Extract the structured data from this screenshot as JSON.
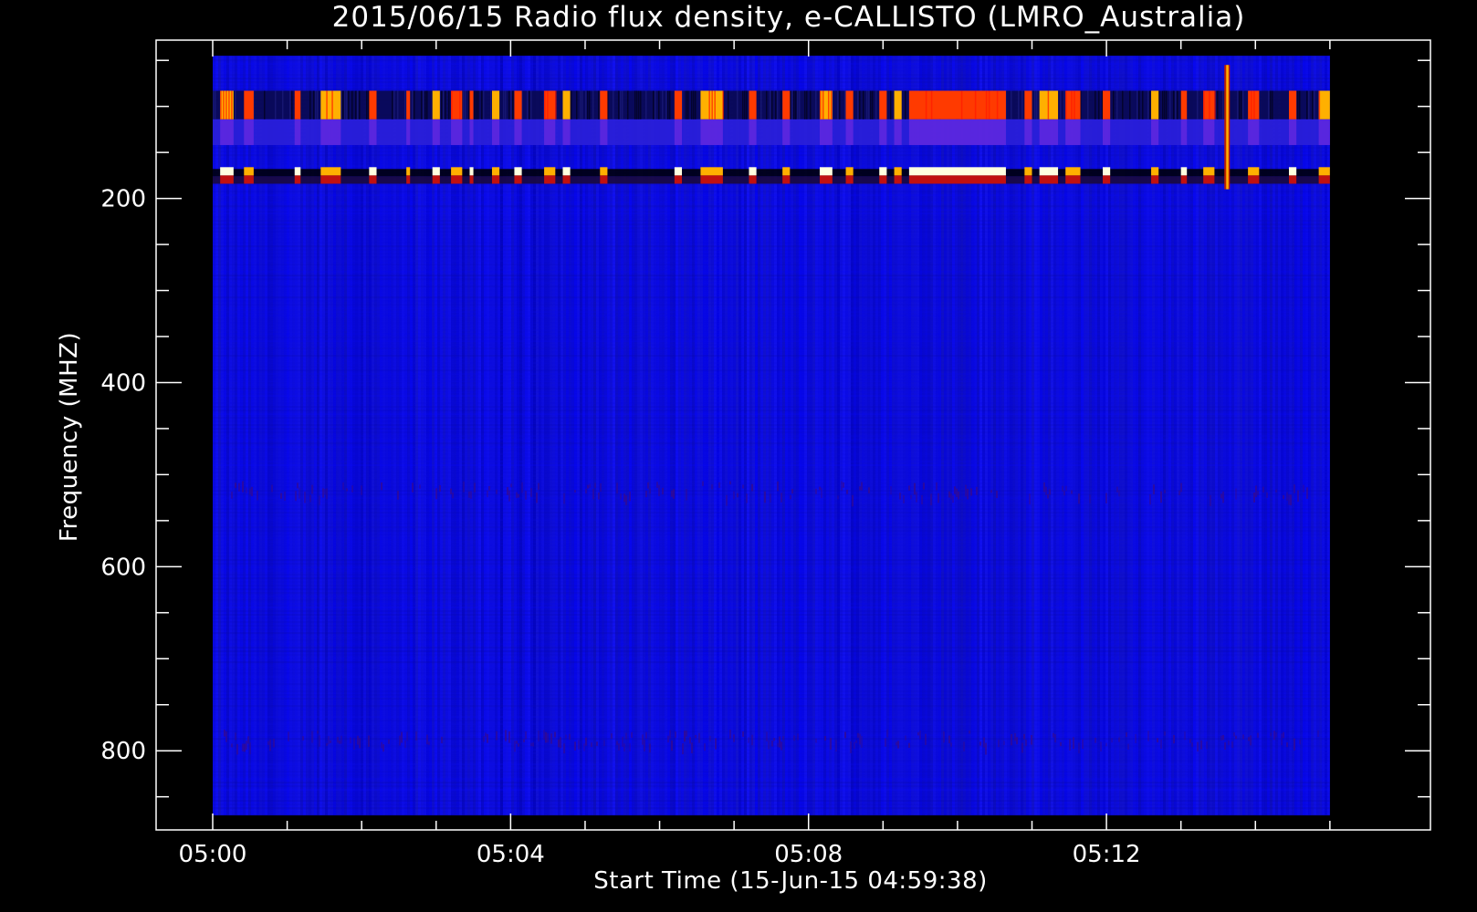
{
  "chart_data": {
    "type": "heatmap",
    "title": "2015/06/15  Radio flux density, e-CALLISTO (LMRO_Australia)",
    "xlabel": "Start Time (15-Jun-15 04:59:38)",
    "ylabel": "Frequency (MHZ)",
    "x_axis": {
      "unit": "UTC time (minutes after 05:00)",
      "range_minutes": [
        -0.76,
        16.35
      ],
      "data_extent_minutes": [
        0,
        15
      ],
      "major_ticks": [
        {
          "minutes": 0,
          "label": "05:00"
        },
        {
          "minutes": 4,
          "label": "05:04"
        },
        {
          "minutes": 8,
          "label": "05:08"
        },
        {
          "minutes": 12,
          "label": "05:12"
        }
      ],
      "minor_step_minutes": 1
    },
    "y_axis": {
      "unit": "MHz",
      "inverted": true,
      "range": [
        28,
        886
      ],
      "data_extent": [
        45,
        870
      ],
      "major_ticks": [
        {
          "value": 200,
          "label": "200"
        },
        {
          "value": 400,
          "label": "400"
        },
        {
          "value": 600,
          "label": "600"
        },
        {
          "value": 800,
          "label": "800"
        }
      ],
      "minor_step": 50
    },
    "colormap": {
      "background": "#000000",
      "low": "#0000c8",
      "mid": "#0000ff",
      "dark": "#000030",
      "warm": "#ff3a00",
      "hot": "#ffb000",
      "white": "#ffffe0"
    },
    "background_level_color": "#0c0cdc",
    "bands": [
      {
        "name": "interference-band-1",
        "freq_range_mhz": [
          83,
          114
        ],
        "color": "#0a0a50"
      },
      {
        "name": "interference-band-2",
        "freq_range_mhz": [
          114,
          142
        ],
        "color": "#2a20d8"
      },
      {
        "name": "interference-band-3",
        "freq_range_mhz": [
          168,
          176
        ],
        "color": "#000010"
      },
      {
        "name": "interference-band-4",
        "freq_range_mhz": [
          176,
          184
        ],
        "color": "#1a0a40"
      }
    ],
    "interference_bursts_minutes": [
      [
        0.1,
        0.28
      ],
      [
        0.42,
        0.55
      ],
      [
        1.1,
        1.18
      ],
      [
        1.45,
        1.72
      ],
      [
        2.1,
        2.2
      ],
      [
        2.6,
        2.65
      ],
      [
        2.95,
        3.05
      ],
      [
        3.2,
        3.35
      ],
      [
        3.45,
        3.5
      ],
      [
        3.75,
        3.85
      ],
      [
        4.05,
        4.15
      ],
      [
        4.45,
        4.6
      ],
      [
        4.7,
        4.8
      ],
      [
        5.2,
        5.3
      ],
      [
        6.2,
        6.3
      ],
      [
        6.55,
        6.85
      ],
      [
        7.2,
        7.3
      ],
      [
        7.65,
        7.75
      ],
      [
        8.15,
        8.32
      ],
      [
        8.5,
        8.6
      ],
      [
        8.95,
        9.05
      ],
      [
        9.15,
        9.25
      ],
      [
        9.35,
        10.65
      ],
      [
        10.9,
        11.0
      ],
      [
        11.1,
        11.35
      ],
      [
        11.45,
        11.65
      ],
      [
        11.95,
        12.05
      ],
      [
        12.6,
        12.7
      ],
      [
        13.0,
        13.08
      ],
      [
        13.3,
        13.45
      ],
      [
        13.6,
        13.62
      ],
      [
        13.9,
        14.05
      ],
      [
        14.45,
        14.55
      ],
      [
        14.85,
        15.0
      ]
    ],
    "vertical_spike": {
      "minutes": 13.62,
      "freq_range_mhz": [
        55,
        190
      ]
    },
    "faint_stripes": [
      {
        "freq_mhz": 515,
        "intensity": 0.25
      },
      {
        "freq_mhz": 785,
        "intensity": 0.3
      }
    ],
    "legend": "none",
    "grid": false
  }
}
